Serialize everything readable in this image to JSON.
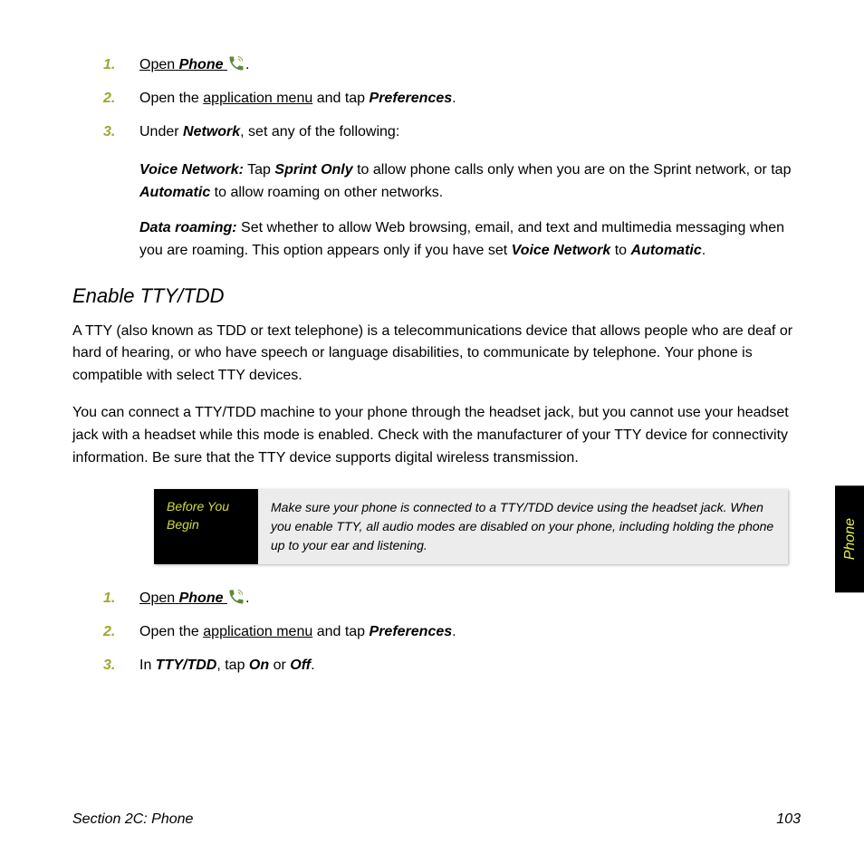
{
  "list1": {
    "s1": {
      "open": "Open",
      "phone": "Phone"
    },
    "s2": {
      "t1": "Open the ",
      "t2": "application menu",
      "t3": " and tap ",
      "t4": "Preferences",
      "t5": "."
    },
    "s3": {
      "t1": "Under ",
      "t2": "Network",
      "t3": ", set any of the following:"
    }
  },
  "voice": {
    "label": "Voice Network:",
    "t1": " Tap ",
    "t2": "Sprint Only",
    "t3": " to allow phone calls only when you are on the Sprint network, or tap ",
    "t4": "Automatic",
    "t5": " to allow roaming on other networks."
  },
  "roam": {
    "label": "Data roaming:",
    "t1": " Set whether to allow Web browsing, email, and text and multimedia messaging when you are roaming. This option appears only if you have set ",
    "t2": "Voice Network",
    "t3": " to ",
    "t4": "Automatic",
    "t5": "."
  },
  "heading": "Enable TTY/TDD",
  "para1": "A TTY (also known as TDD or text telephone) is a telecommunications device that allows people who are deaf or hard of hearing, or who have speech or language disabilities, to communicate by telephone. Your phone is compatible with select TTY devices.",
  "para2": "You can connect a TTY/TDD machine to your phone through the headset jack, but you cannot use your headset jack with a headset while this mode is enabled. Check with the manufacturer of your TTY device for connectivity information. Be sure that the TTY device supports digital wireless transmission.",
  "note": {
    "title": "Before You Begin",
    "body": "Make sure your phone is connected to a TTY/TDD device using the headset jack. When you enable TTY, all audio modes are disabled on your phone, including holding the phone up to your ear and listening."
  },
  "list2": {
    "s1": {
      "open": "Open",
      "phone": "Phone"
    },
    "s2": {
      "t1": "Open the ",
      "t2": "application menu",
      "t3": " and tap ",
      "t4": "Preferences",
      "t5": "."
    },
    "s3": {
      "t1": "In ",
      "t2": "TTY/TDD",
      "t3": ", tap ",
      "t4": "On",
      "t5": " or ",
      "t6": "Off",
      "t7": "."
    }
  },
  "sidetab": "Phone",
  "footer": {
    "left": "Section 2C: Phone",
    "right": "103"
  }
}
